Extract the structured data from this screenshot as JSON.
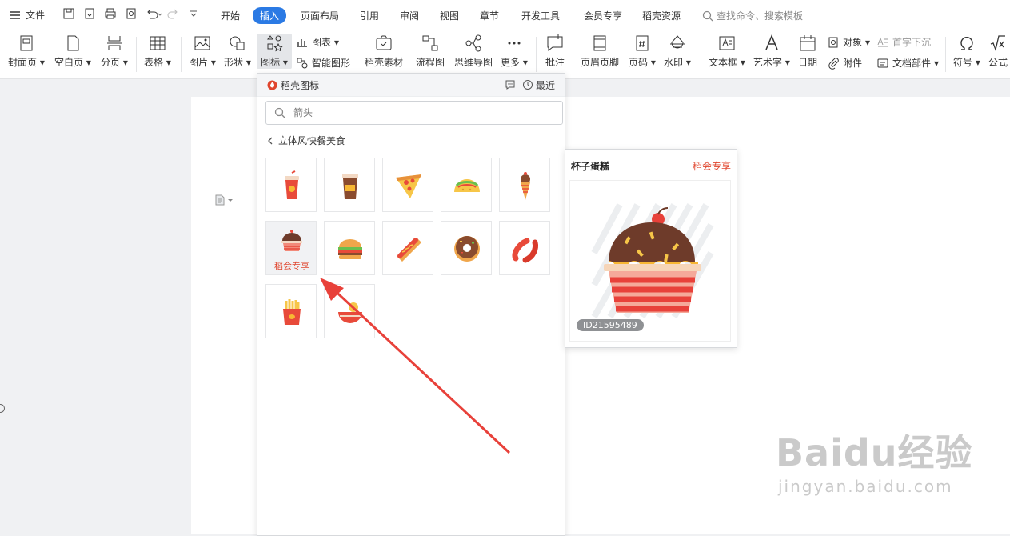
{
  "menubar": {
    "file_label": "文件",
    "tabs": [
      "开始",
      "插入",
      "页面布局",
      "引用",
      "审阅",
      "视图",
      "章节",
      "开发工具",
      "会员专享",
      "稻壳资源"
    ],
    "active_tab": "插入",
    "search_label": "查找命令、搜索模板"
  },
  "ribbon": {
    "cover": "封面页",
    "blank": "空白页",
    "pagebreak": "分页",
    "table": "表格",
    "picture": "图片",
    "shape": "形状",
    "icon": "图标",
    "chart": "图表",
    "smart": "智能图形",
    "material": "稻壳素材",
    "flow": "流程图",
    "mindmap": "思维导图",
    "more": "更多",
    "comment": "批注",
    "header": "页眉页脚",
    "pagenum": "页码",
    "watermark": "水印",
    "textbox": "文本框",
    "wordart": "艺术字",
    "date": "日期",
    "object": "对象",
    "attachment": "附件",
    "dropcap": "首字下沉",
    "docpart": "文档部件",
    "symbol": "符号",
    "formula": "公式"
  },
  "panel": {
    "title": "稻壳图标",
    "recent": "最近",
    "search_placeholder": "箭头",
    "breadcrumb": "立体风快餐美食",
    "vip_tag": "稻会专享",
    "icons": [
      {
        "name": "soda-cup"
      },
      {
        "name": "coffee-cup"
      },
      {
        "name": "pizza-slice"
      },
      {
        "name": "taco"
      },
      {
        "name": "ice-cream-cone"
      },
      {
        "name": "cupcake"
      },
      {
        "name": "hamburger"
      },
      {
        "name": "hotdog"
      },
      {
        "name": "donut"
      },
      {
        "name": "sausage"
      },
      {
        "name": "french-fries"
      },
      {
        "name": "noodle-bowl"
      }
    ]
  },
  "preview": {
    "title": "杯子蛋糕",
    "vip": "稻会专享",
    "id": "ID21595489"
  },
  "watermark": {
    "brand": "Baidu经验",
    "url": "jingyan.baidu.com"
  },
  "colors": {
    "accent": "#2b7ae4",
    "vip_red": "#e0462e",
    "arrow_red": "#e8413a"
  }
}
